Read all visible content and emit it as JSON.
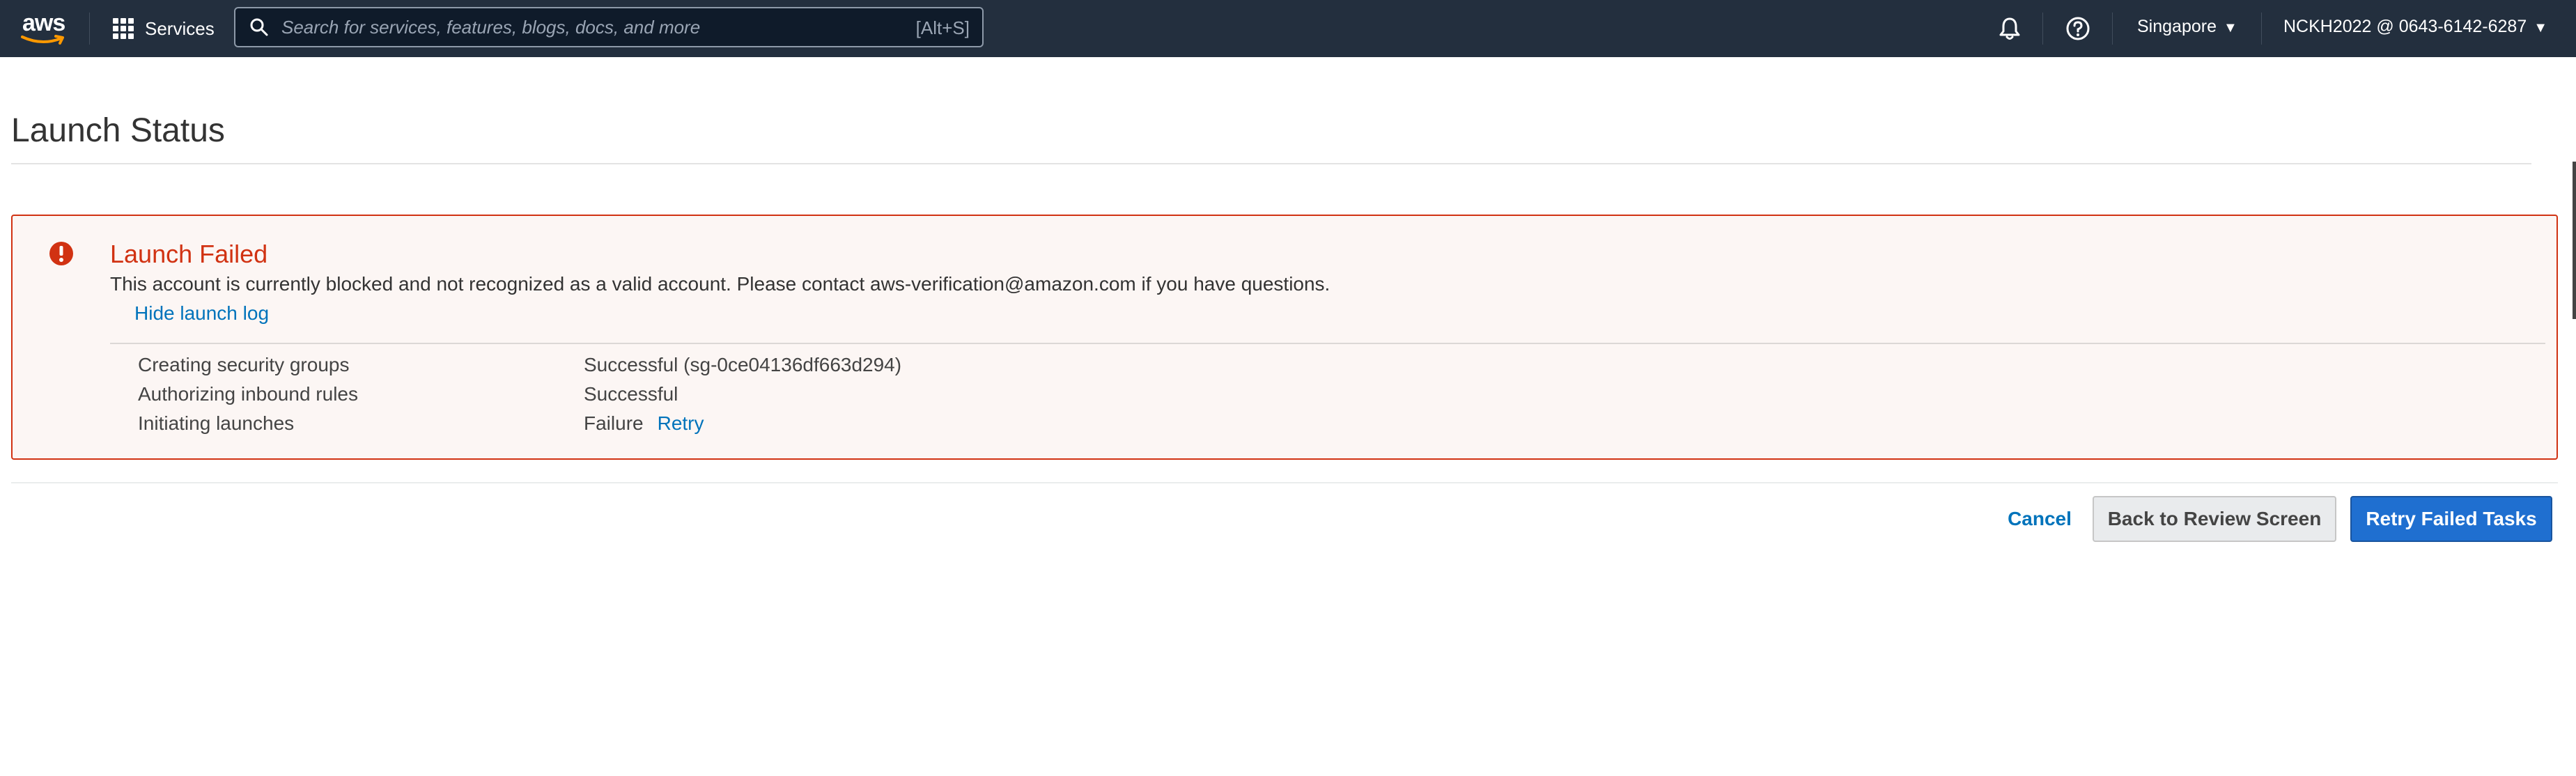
{
  "topnav": {
    "logo_text": "aws",
    "services_label": "Services",
    "search_placeholder": "Search for services, features, blogs, docs, and more",
    "search_shortcut": "[Alt+S]",
    "region": "Singapore",
    "account": "NCKH2022 @ 0643-6142-6287",
    "icons": [
      "services-grid-icon",
      "search-icon",
      "notifications-bell-icon",
      "help-icon",
      "caret-down-icon"
    ],
    "background_color": "#232f3e"
  },
  "page": {
    "title": "Launch Status"
  },
  "alert": {
    "title": "Launch Failed",
    "message": "This account is currently blocked and not recognized as a valid account. Please contact aws-verification@amazon.com if you have questions.",
    "hide_log_label": "Hide launch log",
    "icon": "error-icon",
    "color": "#d13212",
    "log": [
      {
        "task": "Creating security groups",
        "status": "Successful (sg-0ce04136df663d294)"
      },
      {
        "task": "Authorizing inbound rules",
        "status": "Successful"
      },
      {
        "task": "Initiating launches",
        "status": "Failure",
        "action": "Retry"
      }
    ]
  },
  "actions": {
    "cancel": "Cancel",
    "back": "Back to Review Screen",
    "retry": "Retry Failed Tasks",
    "primary_color": "#1f6fd0",
    "link_color": "#0073bb"
  }
}
